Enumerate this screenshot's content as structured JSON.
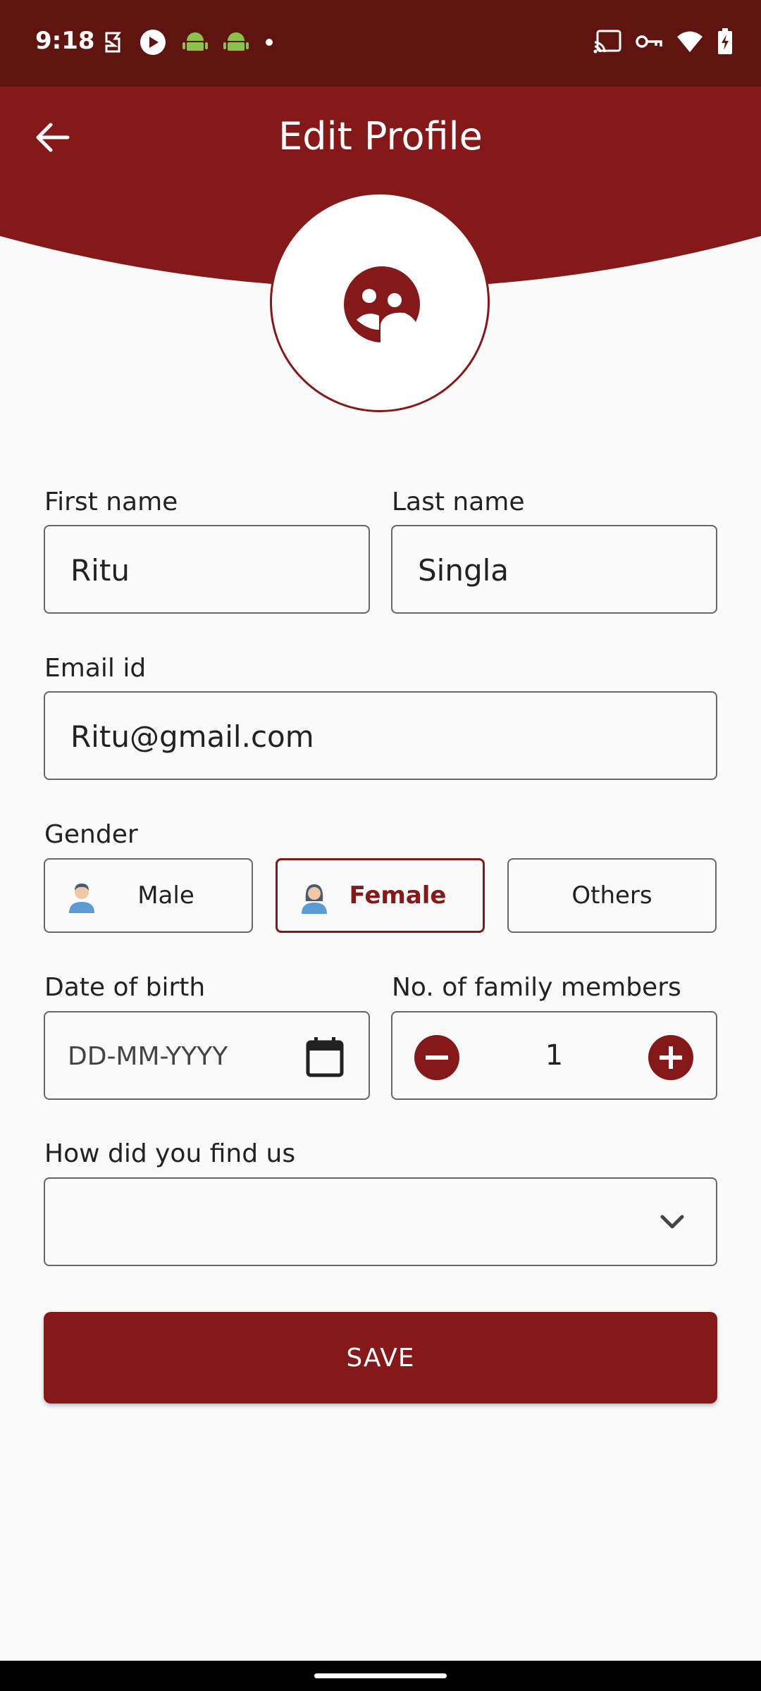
{
  "status_bar": {
    "time": "9:18",
    "left_icons": [
      "app-icon",
      "play-icon",
      "android-icon",
      "android-icon",
      "dot-icon"
    ],
    "right_icons": [
      "cast-icon",
      "vpn-key-icon",
      "wifi-icon",
      "battery-charging-icon"
    ]
  },
  "header": {
    "title": "Edit Profile",
    "back_icon": "back-arrow-icon",
    "color": "#85191a"
  },
  "avatar": {
    "icon": "profile-avatar-icon"
  },
  "form": {
    "first_name": {
      "label": "First name",
      "value": "Ritu"
    },
    "last_name": {
      "label": "Last name",
      "value": "Singla"
    },
    "email": {
      "label": "Email id",
      "value": "Ritu@gmail.com"
    },
    "gender": {
      "label": "Gender",
      "options": [
        {
          "label": "Male",
          "icon": "male-avatar-icon"
        },
        {
          "label": "Female",
          "icon": "female-avatar-icon",
          "selected": true
        },
        {
          "label": "Others"
        }
      ]
    },
    "dob": {
      "label": "Date of birth",
      "placeholder": "DD-MM-YYYY",
      "icon": "calendar-icon"
    },
    "family": {
      "label": "No. of family members",
      "value": "1"
    },
    "source": {
      "label": "How did you find us",
      "value": "",
      "icon": "chevron-down-icon"
    }
  },
  "save_label": "SAVE"
}
